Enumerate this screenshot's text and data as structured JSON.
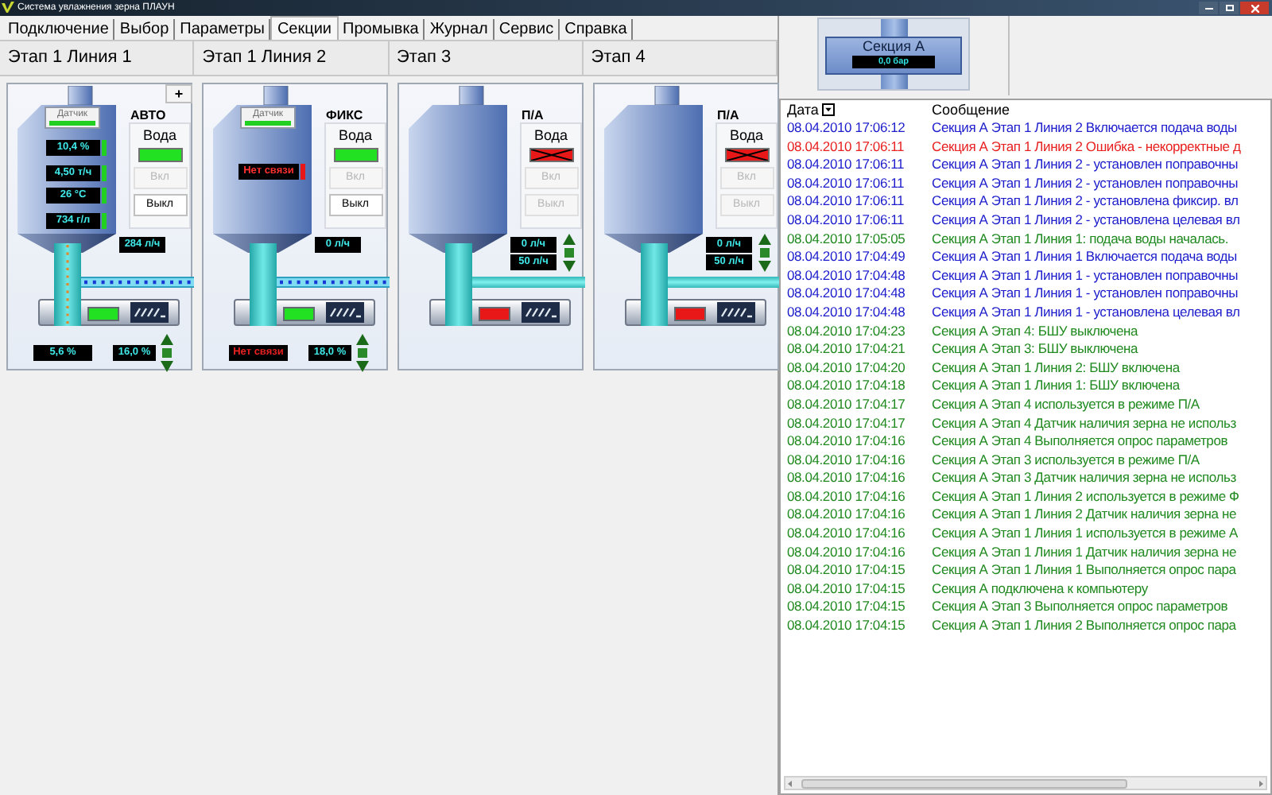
{
  "window": {
    "title": "Система увлажнения зерна ПЛАУН"
  },
  "tabs": [
    {
      "label": "Подключение",
      "selected": false
    },
    {
      "label": "Выбор",
      "selected": false
    },
    {
      "label": "Параметры",
      "selected": false
    },
    {
      "label": "Секции",
      "selected": true
    },
    {
      "label": "Промывка",
      "selected": false
    },
    {
      "label": "Журнал",
      "selected": false
    },
    {
      "label": "Сервис",
      "selected": false
    },
    {
      "label": "Справка",
      "selected": false
    }
  ],
  "stages": [
    {
      "title": "Этап 1 Линия 1",
      "add_button": "+",
      "mode": "АВТО",
      "sensor": {
        "label": "Датчик",
        "ok": true
      },
      "water": {
        "label": "Вода",
        "on": true
      },
      "buttons": [
        {
          "label": "Вкл",
          "disabled": true
        },
        {
          "label": "Выкл",
          "disabled": false
        }
      ],
      "readings": [
        {
          "text": "10,4 %",
          "ok": true
        },
        {
          "text": "4,50 т/ч",
          "ok": true
        },
        {
          "text": "26 °C",
          "ok": true
        },
        {
          "text": "734 г/л",
          "ok": true
        }
      ],
      "flows": [
        "284 л/ч"
      ],
      "grain_flowing": true,
      "water_flowing": true,
      "conveyor_on": true,
      "outputs": [
        {
          "text": "5,6 %",
          "ok": true
        },
        {
          "text": "16,0 %",
          "ok": true
        }
      ]
    },
    {
      "title": "Этап 1 Линия 2",
      "mode": "ФИКС",
      "sensor": {
        "label": "Датчик",
        "ok": true
      },
      "water": {
        "label": "Вода",
        "on": true
      },
      "buttons": [
        {
          "label": "Вкл",
          "disabled": true
        },
        {
          "label": "Выкл",
          "disabled": false
        }
      ],
      "readings": [
        {
          "text": "Нет связи",
          "ok": false
        }
      ],
      "flows": [
        "0 л/ч"
      ],
      "grain_flowing": false,
      "water_flowing": true,
      "conveyor_on": true,
      "outputs": [
        {
          "text": "Нет связи",
          "ok": false
        },
        {
          "text": "18,0 %",
          "ok": true
        }
      ]
    },
    {
      "title": "Этап 3",
      "mode": "П/А",
      "water": {
        "label": "Вода",
        "on": false
      },
      "buttons": [
        {
          "label": "Вкл",
          "disabled": true
        },
        {
          "label": "Выкл",
          "disabled": true
        }
      ],
      "flows": [
        "0 л/ч",
        "50 л/ч"
      ],
      "grain_flowing": false,
      "water_flowing": false,
      "conveyor_on": false
    },
    {
      "title": "Этап 4",
      "mode": "П/А",
      "water": {
        "label": "Вода",
        "on": false
      },
      "buttons": [
        {
          "label": "Вкл",
          "disabled": true
        },
        {
          "label": "Выкл",
          "disabled": true
        }
      ],
      "flows": [
        "0 л/ч",
        "50 л/ч"
      ],
      "grain_flowing": false,
      "water_flowing": false,
      "conveyor_on": false
    }
  ],
  "section": {
    "name": "Секция А",
    "pressure": "0,0 бар"
  },
  "log": {
    "columns": [
      {
        "label": "Дата",
        "sortable": true
      },
      {
        "label": "Сообщение"
      }
    ],
    "rows": [
      {
        "date": "08.04.2010 17:06:12",
        "message": "Секция А Этап 1 Линия 2 Включается подача воды",
        "color": "#1c1ccc"
      },
      {
        "date": "08.04.2010 17:06:11",
        "message": "Секция А Этап 1 Линия 2 Ошибка - некорректные д",
        "color": "#e82020"
      },
      {
        "date": "08.04.2010 17:06:11",
        "message": "Секция А Этап 1 Линия 2 - установлен поправочны",
        "color": "#1c1ccc"
      },
      {
        "date": "08.04.2010 17:06:11",
        "message": "Секция А Этап 1 Линия 2 - установлен поправочны",
        "color": "#1c1ccc"
      },
      {
        "date": "08.04.2010 17:06:11",
        "message": "Секция А Этап 1 Линия 2 - установлена фиксир. вл",
        "color": "#1c1ccc"
      },
      {
        "date": "08.04.2010 17:06:11",
        "message": "Секция А Этап 1 Линия 2 - установлена целевая вл",
        "color": "#1c1ccc"
      },
      {
        "date": "08.04.2010 17:05:05",
        "message": "Секция А Этап 1 Линия 1: подача воды началась.",
        "color": "#208a20"
      },
      {
        "date": "08.04.2010 17:04:49",
        "message": "Секция А Этап 1 Линия 1 Включается подача воды",
        "color": "#1c1ccc"
      },
      {
        "date": "08.04.2010 17:04:48",
        "message": "Секция А Этап 1 Линия 1 - установлен поправочны",
        "color": "#1c1ccc"
      },
      {
        "date": "08.04.2010 17:04:48",
        "message": "Секция А Этап 1 Линия 1 - установлен поправочны",
        "color": "#1c1ccc"
      },
      {
        "date": "08.04.2010 17:04:48",
        "message": "Секция А Этап 1 Линия 1 - установлена целевая вл",
        "color": "#1c1ccc"
      },
      {
        "date": "08.04.2010 17:04:23",
        "message": "Секция А Этап 4: БШУ выключена",
        "color": "#208a20"
      },
      {
        "date": "08.04.2010 17:04:21",
        "message": "Секция А Этап 3: БШУ выключена",
        "color": "#208a20"
      },
      {
        "date": "08.04.2010 17:04:20",
        "message": "Секция А Этап 1 Линия 2: БШУ включена",
        "color": "#208a20"
      },
      {
        "date": "08.04.2010 17:04:18",
        "message": "Секция А Этап 1 Линия 1: БШУ включена",
        "color": "#208a20"
      },
      {
        "date": "08.04.2010 17:04:17",
        "message": "Секция А Этап 4 используется в режиме П/А",
        "color": "#208a20"
      },
      {
        "date": "08.04.2010 17:04:17",
        "message": "Секция А Этап 4 Датчик наличия зерна  не использ",
        "color": "#208a20"
      },
      {
        "date": "08.04.2010 17:04:16",
        "message": "Секция А Этап 4 Выполняется опрос параметров",
        "color": "#208a20"
      },
      {
        "date": "08.04.2010 17:04:16",
        "message": "Секция А Этап 3 используется в режиме П/А",
        "color": "#208a20"
      },
      {
        "date": "08.04.2010 17:04:16",
        "message": "Секция А Этап 3 Датчик наличия зерна  не использ",
        "color": "#208a20"
      },
      {
        "date": "08.04.2010 17:04:16",
        "message": "Секция А Этап 1 Линия 2 используется в режиме Ф",
        "color": "#208a20"
      },
      {
        "date": "08.04.2010 17:04:16",
        "message": "Секция А Этап 1 Линия 2 Датчик наличия зерна  не",
        "color": "#208a20"
      },
      {
        "date": "08.04.2010 17:04:16",
        "message": "Секция А Этап 1 Линия 1 используется в режиме А",
        "color": "#208a20"
      },
      {
        "date": "08.04.2010 17:04:16",
        "message": "Секция А Этап 1 Линия 1 Датчик наличия зерна  не",
        "color": "#208a20"
      },
      {
        "date": "08.04.2010 17:04:15",
        "message": "Секция А Этап 1 Линия 1 Выполняется опрос пара",
        "color": "#208a20"
      },
      {
        "date": "08.04.2010 17:04:15",
        "message": "Секция А подключена к компьютеру",
        "color": "#208a20"
      },
      {
        "date": "08.04.2010 17:04:15",
        "message": "Секция А Этап 3 Выполняется опрос параметров",
        "color": "#208a20"
      },
      {
        "date": "08.04.2010 17:04:15",
        "message": "Секция А Этап 1 Линия 2 Выполняется опрос пара",
        "color": "#208a20"
      }
    ]
  }
}
